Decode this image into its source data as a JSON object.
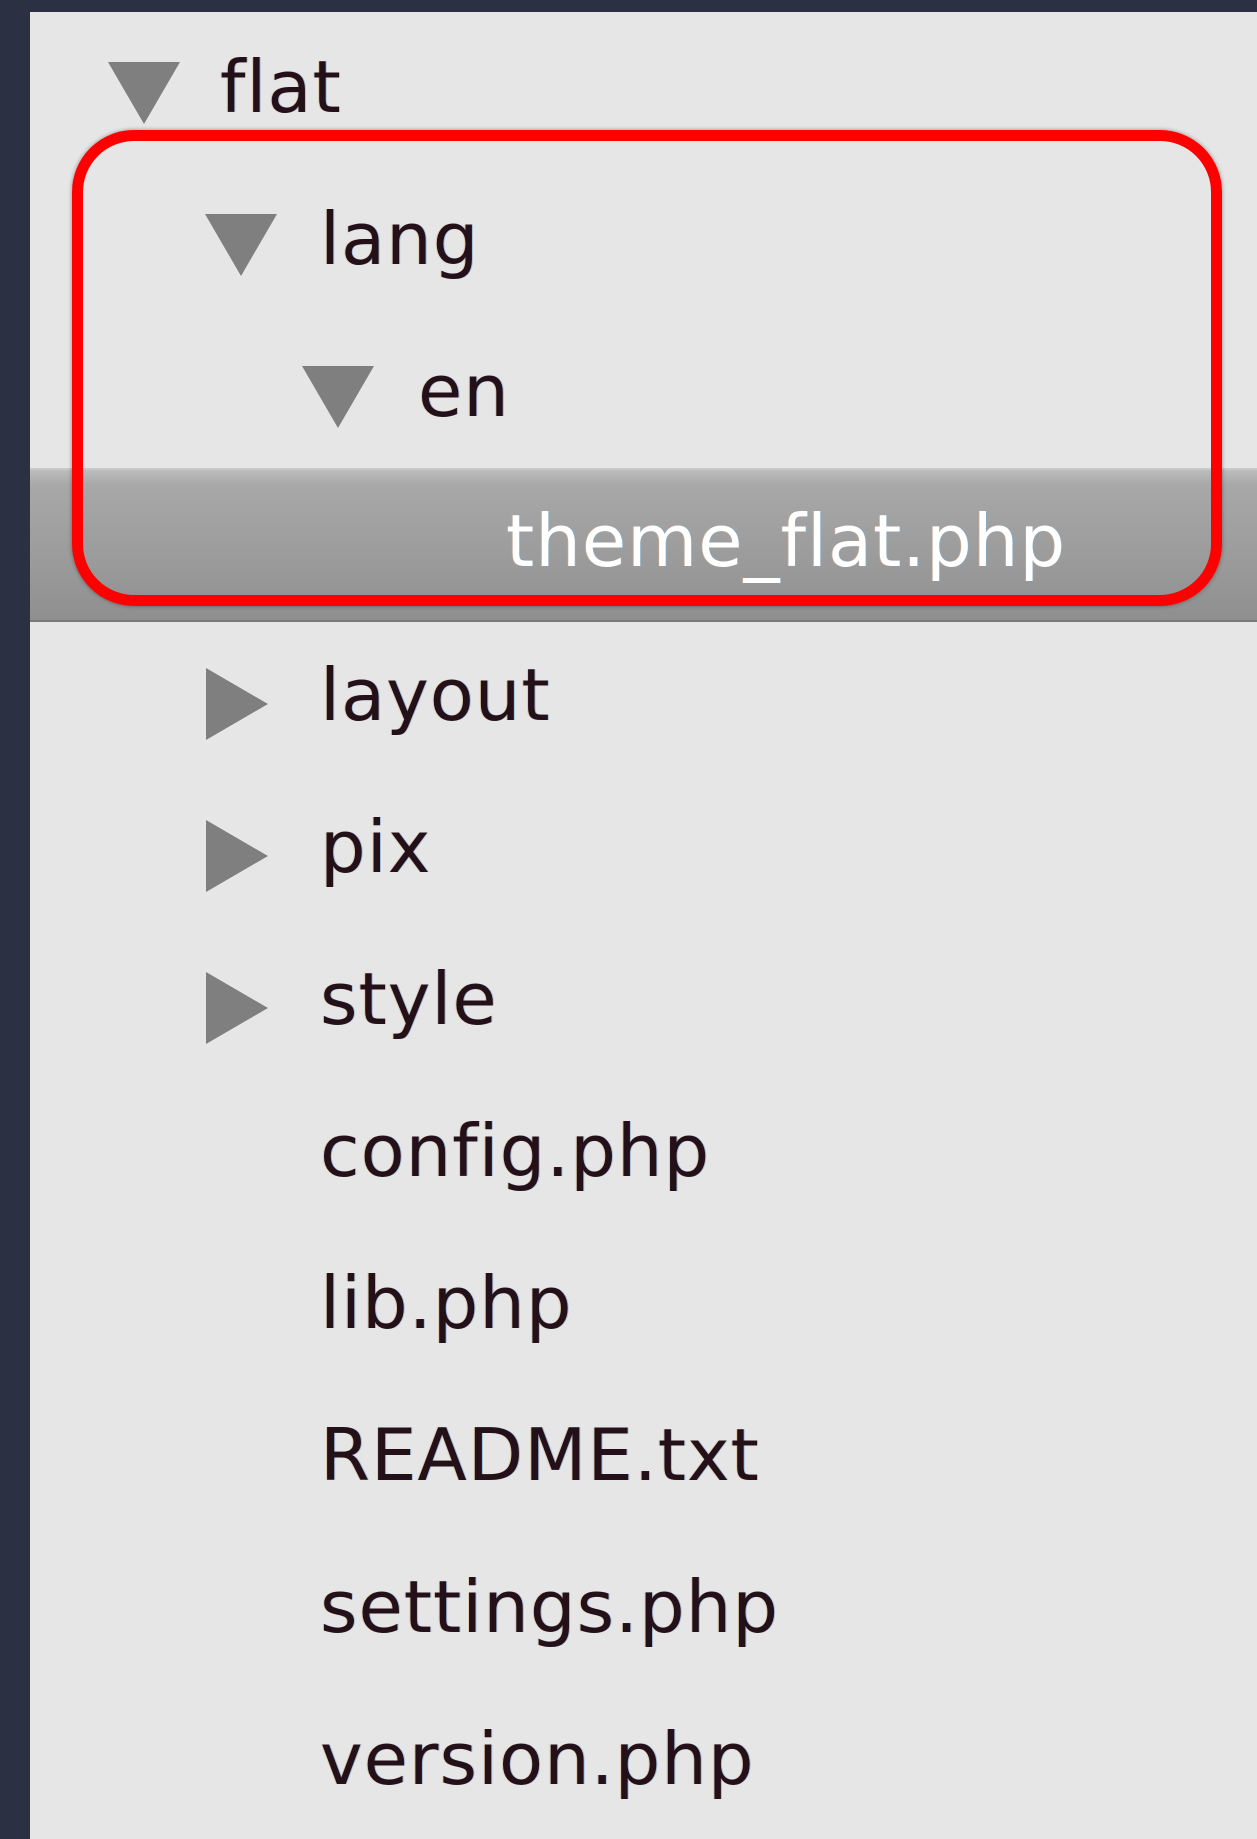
{
  "tree": {
    "items": [
      {
        "label": "flat",
        "expander": "expanded-triangle-icon"
      },
      {
        "label": "lang",
        "expander": "expanded-triangle-icon"
      },
      {
        "label": "en",
        "expander": "expanded-triangle-icon"
      },
      {
        "label": "theme_flat.php",
        "selected": true
      },
      {
        "label": "layout",
        "expander": "collapsed-triangle-icon"
      },
      {
        "label": "pix",
        "expander": "collapsed-triangle-icon"
      },
      {
        "label": "style",
        "expander": "collapsed-triangle-icon"
      },
      {
        "label": "config.php"
      },
      {
        "label": "lib.php"
      },
      {
        "label": "README.txt"
      },
      {
        "label": "settings.php"
      },
      {
        "label": "version.php"
      }
    ]
  },
  "colors": {
    "panel_background": "#e6e6e6",
    "window_frame": "#2b3143",
    "highlight_border": "#ff0000",
    "selected_row": "#9b9b9b",
    "triangle": "#7f7f7f"
  }
}
